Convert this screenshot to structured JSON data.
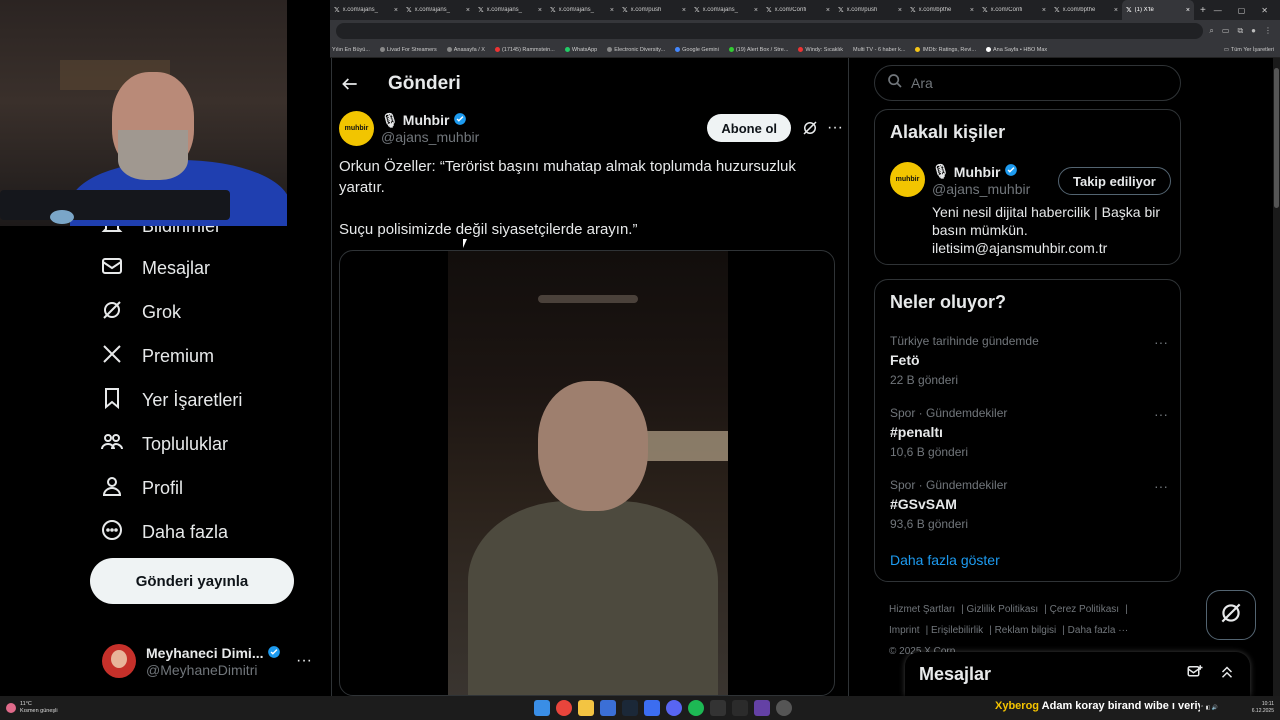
{
  "browser": {
    "tabs": [
      {
        "title": "x.com/ajans_"
      },
      {
        "title": "x.com/ajans_"
      },
      {
        "title": "x.com/ajans_"
      },
      {
        "title": "x.com/ajans_"
      },
      {
        "title": "x.com/push"
      },
      {
        "title": "x.com/ajans_"
      },
      {
        "title": "x.com/Confi"
      },
      {
        "title": "x.com/push"
      },
      {
        "title": "x.com/bpthe"
      },
      {
        "title": "x.com/Confi"
      },
      {
        "title": "x.com/bpthe"
      },
      {
        "title": "(1) X'te"
      }
    ],
    "bookmarks": [
      "Yılın En Büyü...",
      "Livad For Streamers",
      "Anasayfa / X",
      "(17145) Rammstein...",
      "WhatsApp",
      "Electronic Diversity...",
      "Google Gemini",
      "(19) Alert Box / Stre...",
      "Windy: Sıcaklık",
      "Multi TV - 6 haber k...",
      "IMDb: Ratings, Revi...",
      "Ana Sayfa • HBO Max"
    ],
    "all_bookmarks": "Tüm Yer İşaretleri"
  },
  "nav": {
    "items": [
      {
        "label": "Bildirimler",
        "icon": "bell-icon"
      },
      {
        "label": "Mesajlar",
        "icon": "mail-icon"
      },
      {
        "label": "Grok",
        "icon": "grok-icon"
      },
      {
        "label": "Premium",
        "icon": "x-logo-icon"
      },
      {
        "label": "Yer İşaretleri",
        "icon": "bookmark-icon"
      },
      {
        "label": "Topluluklar",
        "icon": "communities-icon"
      },
      {
        "label": "Profil",
        "icon": "profile-icon"
      },
      {
        "label": "Daha fazla",
        "icon": "more-circle-icon"
      }
    ],
    "post_button": "Gönderi yayınla",
    "account": {
      "name": "Meyhaneci Dimi...",
      "handle": "@MeyhaneDimitri"
    }
  },
  "main": {
    "title": "Gönderi",
    "author": {
      "name": "Muhbir",
      "handle": "@ajans_muhbir",
      "avatar_text": "muhbir"
    },
    "follow_button": "Abone ol",
    "text_line1": "Orkun Özeller: “Terörist başını muhatap almak toplumda huzursuzluk yaratır.",
    "text_line2": "Suçu polisimizde değil siyasetçilerde arayın.”"
  },
  "right": {
    "search_placeholder": "Ara",
    "related": {
      "title": "Alakalı kişiler",
      "name": "Muhbir",
      "handle": "@ajans_muhbir",
      "follow_button": "Takip ediliyor",
      "bio": "Yeni nesil dijital habercilik | Başka bir basın mümkün. iletisim@ajansmuhbir.com.tr"
    },
    "trends": {
      "title": "Neler oluyor?",
      "items": [
        {
          "category": "Türkiye tarihinde gündemde",
          "name": "Fetö",
          "count": "22 B gönderi"
        },
        {
          "category": "Spor · Gündemdekiler",
          "name": "#penaltı",
          "count": "10,6 B gönderi"
        },
        {
          "category": "Spor · Gündemdekiler",
          "name": "#GSvSAM",
          "count": "93,6 B gönderi"
        }
      ],
      "show_more": "Daha fazla göster"
    },
    "footer": [
      "Hizmet Şartları",
      "Gizlilik Politikası",
      "Çerez Politikası",
      "Imprint",
      "Erişilebilirlik",
      "Reklam bilgisi",
      "Daha fazla ···",
      "© 2025 X Corp."
    ],
    "messages_drawer": "Mesajlar"
  },
  "taskbar": {
    "weather_temp": "11°C",
    "weather_desc": "Kısmen güneşli",
    "ticker_user": "Xyberog",
    "ticker_text": "Adam koray birand wibe ı veriyo",
    "time": "10:11",
    "date": "6.12.2025"
  },
  "colors": {
    "accent": "#1d9bf0",
    "verified": "#1d9bf0",
    "muhbir_yellow": "#f2c500"
  }
}
